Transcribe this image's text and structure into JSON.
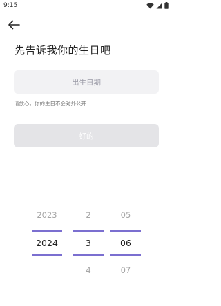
{
  "status_bar": {
    "time": "9:15"
  },
  "header": {
    "back_icon": "arrow-left-icon"
  },
  "page": {
    "title": "先告诉我你的生日吧",
    "birthday_placeholder": "出生日期",
    "privacy_note": "请放心，你的生日不会对外公开",
    "ok_label": "好的"
  },
  "picker": {
    "year": {
      "prev": "2023",
      "selected": "2024",
      "next": ""
    },
    "month": {
      "prev": "2",
      "selected": "3",
      "next": "4"
    },
    "day": {
      "prev": "05",
      "selected": "06",
      "next": "07"
    },
    "accent_color": "#7b6fd0"
  }
}
